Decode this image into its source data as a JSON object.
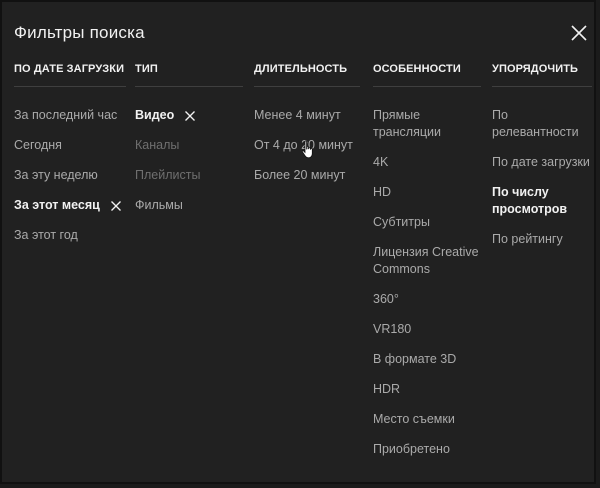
{
  "dialog": {
    "title": "Фильтры поиска",
    "close_icon": "close-icon"
  },
  "columns": [
    {
      "header": "ПО ДАТЕ ЗАГРУЗКИ",
      "items": [
        {
          "label": "За последний час",
          "state": "normal"
        },
        {
          "label": "Сегодня",
          "state": "normal"
        },
        {
          "label": "За эту неделю",
          "state": "normal"
        },
        {
          "label": "За этот месяц",
          "state": "selected"
        },
        {
          "label": "За этот год",
          "state": "normal"
        }
      ]
    },
    {
      "header": "ТИП",
      "items": [
        {
          "label": "Видео",
          "state": "selected"
        },
        {
          "label": "Каналы",
          "state": "disabled"
        },
        {
          "label": "Плейлисты",
          "state": "disabled"
        },
        {
          "label": "Фильмы",
          "state": "normal"
        }
      ]
    },
    {
      "header": "ДЛИТЕЛЬНОСТЬ",
      "items": [
        {
          "label": "Менее 4 минут",
          "state": "normal"
        },
        {
          "label": "От 4 до 20 минут",
          "state": "normal"
        },
        {
          "label": "Более 20 минут",
          "state": "normal"
        }
      ]
    },
    {
      "header": "ОСОБЕННОСТИ",
      "items": [
        {
          "label": "Прямые трансляции",
          "state": "normal"
        },
        {
          "label": "4K",
          "state": "normal"
        },
        {
          "label": "HD",
          "state": "normal"
        },
        {
          "label": "Субтитры",
          "state": "normal"
        },
        {
          "label": "Лицензия Creative Commons",
          "state": "normal"
        },
        {
          "label": "360°",
          "state": "normal"
        },
        {
          "label": "VR180",
          "state": "normal"
        },
        {
          "label": "В формате 3D",
          "state": "normal"
        },
        {
          "label": "HDR",
          "state": "normal"
        },
        {
          "label": "Место съемки",
          "state": "normal"
        },
        {
          "label": "Приобретено",
          "state": "normal"
        }
      ]
    },
    {
      "header": "УПОРЯДОЧИТЬ",
      "items": [
        {
          "label": "По релевантности",
          "state": "normal"
        },
        {
          "label": "По дате загрузки",
          "state": "normal"
        },
        {
          "label": "По числу просмотров",
          "state": "selected"
        },
        {
          "label": "По рейтингу",
          "state": "normal"
        }
      ]
    }
  ],
  "colors": {
    "background": "#212121",
    "text_primary": "#f1f1f1",
    "text_secondary": "#aaaaaa",
    "text_disabled": "#6f6f6f",
    "divider": "#3f3f3f"
  }
}
